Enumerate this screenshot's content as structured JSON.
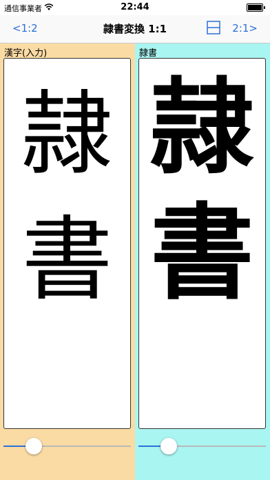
{
  "status_bar": {
    "carrier": "通信事業者",
    "time": "22:44"
  },
  "nav": {
    "back_label": "<1:2",
    "title": "隷書変換 1:1",
    "forward_label": "2:1>"
  },
  "left_panel": {
    "label": "漢字(入力)",
    "chars": [
      "隷",
      "書"
    ],
    "slider_value": 0.2
  },
  "right_panel": {
    "label": "隷書",
    "chars": [
      "隷",
      "書"
    ],
    "slider_value": 0.2
  },
  "colors": {
    "accent": "#2a6fd6",
    "left_bg": "#fbdba4",
    "right_bg": "#a9f5f1"
  }
}
